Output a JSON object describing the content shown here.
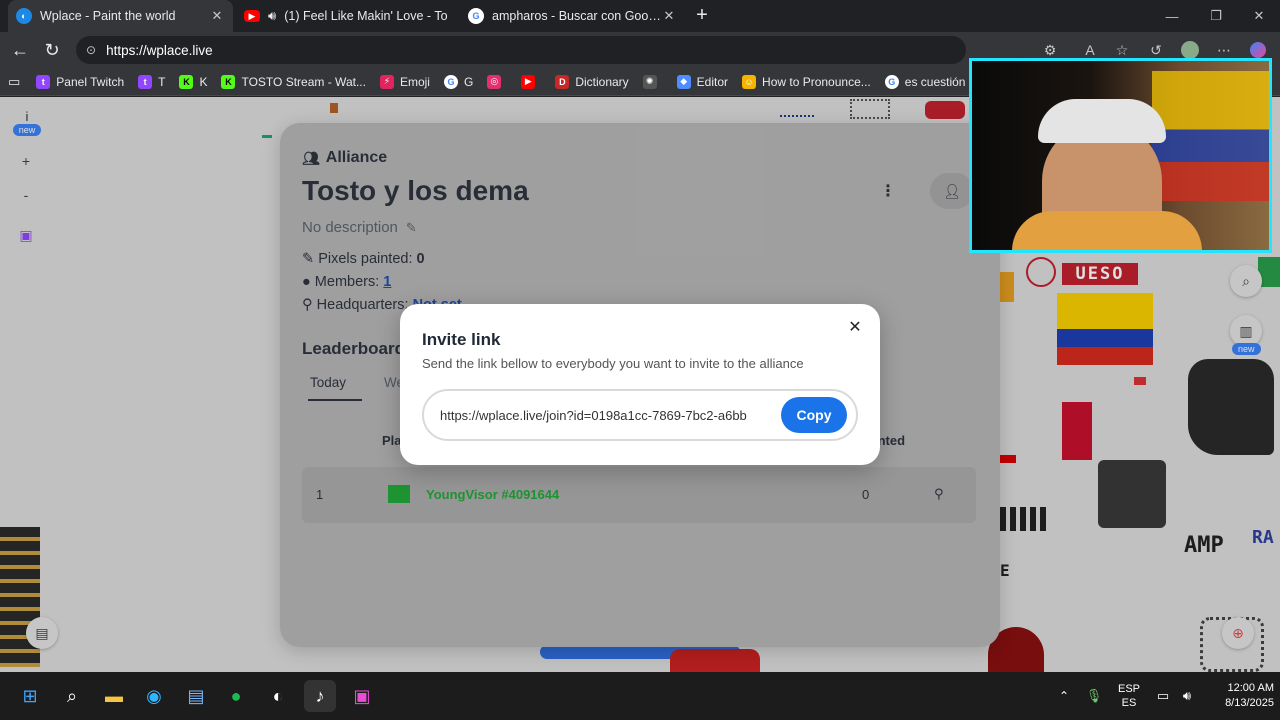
{
  "tabs": [
    {
      "title": "Wplace - Paint the world",
      "favicon": "globe-icon",
      "active": true
    },
    {
      "title": "(1) Feel Like Makin' Love - To",
      "favicon": "youtube-icon",
      "active": false
    },
    {
      "title": "ampharos - Buscar con Google",
      "favicon": "google-icon",
      "active": false
    }
  ],
  "address_bar": {
    "url": "https://wplace.live"
  },
  "bookmarks": [
    {
      "label": "Panel Twitch",
      "icon": "twitch-icon",
      "color": "#9146ff"
    },
    {
      "label": "T",
      "icon": "twitch-icon",
      "color": "#9146ff"
    },
    {
      "label": "K",
      "icon": "kick-icon",
      "color": "#53fc18"
    },
    {
      "label": "TOSTO Stream - Wat...",
      "icon": "kick-icon",
      "color": "#53fc18"
    },
    {
      "label": "Emoji",
      "icon": "bolt-icon",
      "color": "#e0245e"
    },
    {
      "label": "G",
      "icon": "google-icon",
      "color": "#4285f4"
    },
    {
      "label": "",
      "icon": "instagram-icon",
      "color": "#e1306c"
    },
    {
      "label": "",
      "icon": "youtube-icon",
      "color": "#ff0000"
    },
    {
      "label": "Dictionary",
      "icon": "dictionary-icon",
      "color": "#c62828"
    },
    {
      "label": "",
      "icon": "openai-icon",
      "color": "#bbbbbb"
    },
    {
      "label": "Editor",
      "icon": "editor-icon",
      "color": "#4f8cff"
    },
    {
      "label": "How to Pronounce...",
      "icon": "pronounce-icon",
      "color": "#f4b400"
    },
    {
      "label": "es cuestión de t",
      "icon": "google-icon",
      "color": "#4285f4"
    }
  ],
  "left_toolbar": {
    "info": "i",
    "new_badge": "new",
    "zoom_in": "+",
    "zoom_out": "-"
  },
  "right_toolbar": {
    "new_badge": "new"
  },
  "alliance": {
    "heading": "Alliance",
    "name": "Tosto y los dema",
    "description": "No description",
    "pixels_label": "Pixels painted:",
    "pixels_value": "0",
    "members_label": "Members:",
    "members_value": "1",
    "hq_label": "Headquarters:",
    "hq_value": "Not set",
    "leaderboard_title": "Leaderboard",
    "tabs": [
      "Today",
      "We"
    ],
    "col_place": "Pla",
    "col_painted": "inted",
    "rows": [
      {
        "rank": "1",
        "player": "YoungVisor",
        "id": "#4091644",
        "painted": "0"
      }
    ]
  },
  "modal": {
    "title": "Invite link",
    "description": "Send the link bellow to everybody you want to invite to the alliance",
    "link": "https://wplace.live/join?id=0198a1cc-7869-7bc2-a6bb",
    "copy_label": "Copy"
  },
  "map_text": {
    "ueso": "UESO",
    "amp": "AMP",
    "ra": "RA",
    "e": "E"
  },
  "taskbar": {
    "lang_top": "ESP",
    "lang_bottom": "ES",
    "time": "12:00 AM",
    "date": "8/13/2025"
  },
  "colors": {
    "accent_blue": "#1a73e8",
    "webcam_border": "#22e6ff",
    "player_green": "#22a83a"
  }
}
